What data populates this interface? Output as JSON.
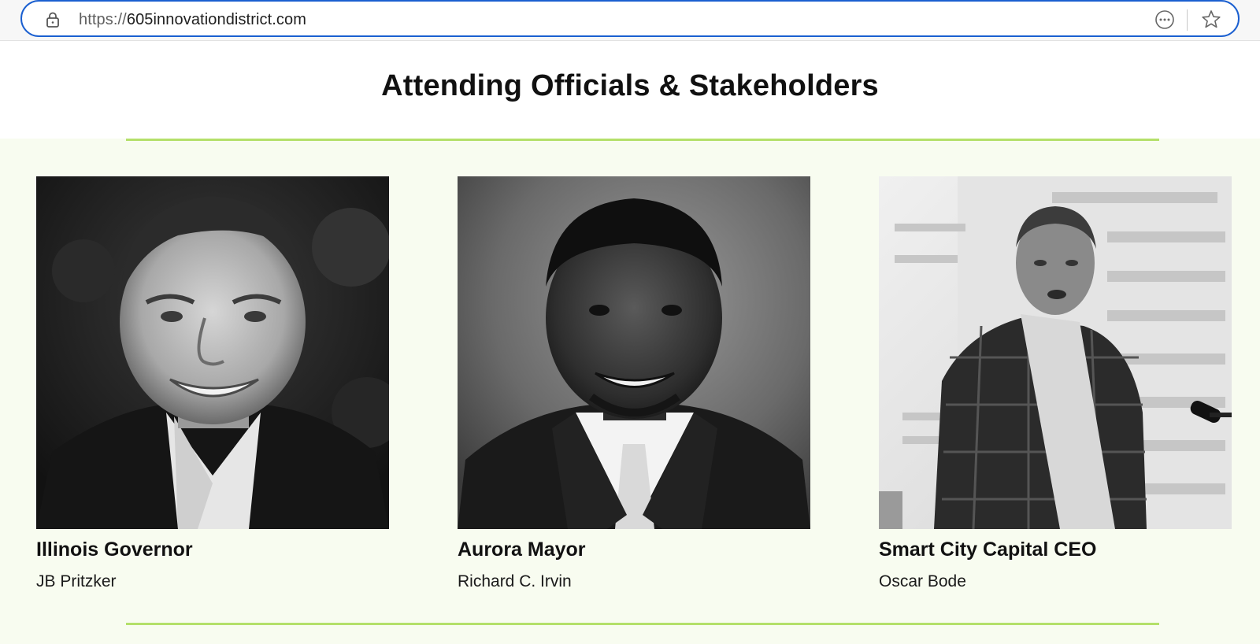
{
  "browser": {
    "url_scheme": "https://",
    "url_host": "605innovationdistrict.com"
  },
  "page": {
    "title": "Attending Officials & Stakeholders"
  },
  "people": [
    {
      "role": "Illinois Governor",
      "name": "JB Pritzker"
    },
    {
      "role": "Aurora Mayor",
      "name": "Richard C. Irvin"
    },
    {
      "role": "Smart City Capital CEO",
      "name": "Oscar Bode"
    }
  ],
  "colors": {
    "accent_green": "#b4e06a",
    "section_background": "#f8fcf0",
    "url_border": "#1a5fd0"
  },
  "icons": [
    "lock-icon",
    "more-options-icon",
    "favorite-star-icon"
  ]
}
